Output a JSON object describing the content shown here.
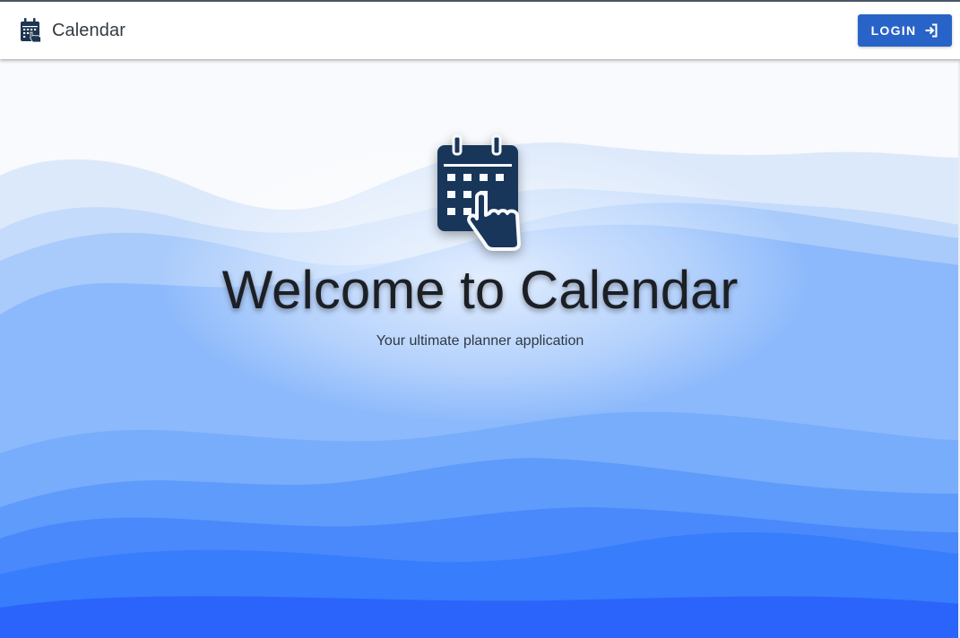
{
  "appbar": {
    "title": "Calendar",
    "brand_icon": "calendar-touch-icon",
    "login_label": "LOGIN",
    "login_icon": "login-icon"
  },
  "hero": {
    "icon": "calendar-touch-icon",
    "title": "Welcome to Calendar",
    "subtitle": "Your ultimate planner application"
  },
  "colors": {
    "primary": "#2863c8",
    "brand_icon": "#1e3552",
    "hero_icon": "#18365a",
    "title_text": "#1c1f24",
    "wave_lightest": "#dce9fb",
    "wave_deepest": "#2b64fb"
  }
}
